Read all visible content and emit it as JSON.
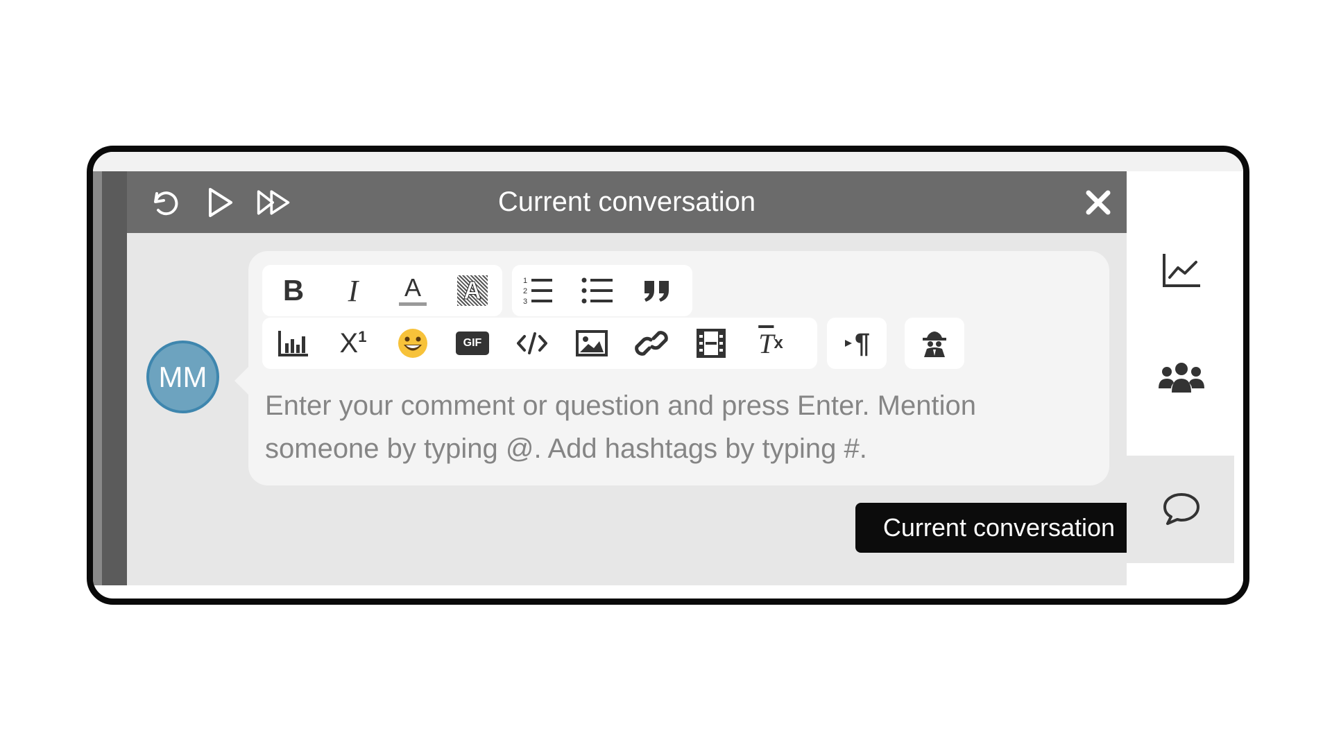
{
  "header": {
    "title": "Current conversation",
    "buttons": [
      {
        "name": "undo-icon"
      },
      {
        "name": "play-icon"
      },
      {
        "name": "fast-forward-icon"
      },
      {
        "name": "close-icon"
      }
    ]
  },
  "avatar": {
    "initials": "MM",
    "color": "#6da3bf"
  },
  "toolbar": {
    "row1": [
      "bold-icon",
      "italic-icon",
      "font-color-icon",
      "highlight-icon",
      "numbered-list-icon",
      "bulleted-list-icon",
      "quote-icon"
    ],
    "row2": [
      "chart-icon",
      "superscript-icon",
      "emoji-icon",
      "gif-icon",
      "code-icon",
      "image-icon",
      "link-icon",
      "video-icon",
      "clear-format-icon",
      "paragraph-direction-icon",
      "anonymous-icon"
    ],
    "gif_label": "GIF",
    "superscript_label": "X",
    "superscript_sup": "1",
    "clear_format_label": "T",
    "clear_format_sub": "x",
    "paragraph_label": "¶",
    "bold_label": "B",
    "italic_label": "I",
    "font_color_label": "A",
    "highlight_label": "A"
  },
  "comment": {
    "placeholder": "Enter your comment or question and press Enter. Mention someone by typing @. Add hashtags by typing #."
  },
  "sidebar": {
    "items": [
      {
        "name": "analytics-icon"
      },
      {
        "name": "participants-icon"
      },
      {
        "name": "conversation-icon",
        "active": true
      }
    ],
    "tooltip": "Current conversation"
  },
  "colors": {
    "header": "#6b6b6b",
    "panel": "#e7e7e7",
    "avatar_border": "#3e86ae"
  }
}
